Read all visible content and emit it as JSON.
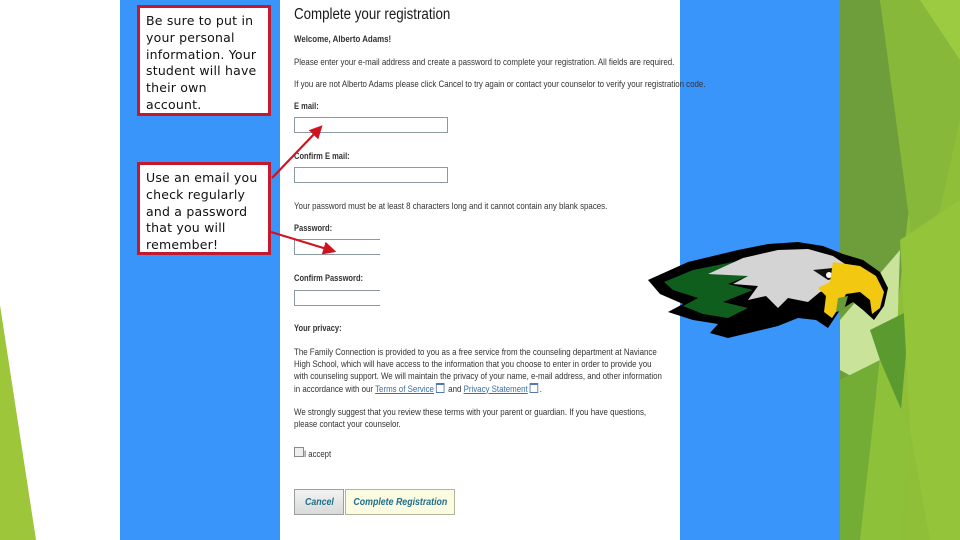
{
  "colors": {
    "blue_panel": "#3a95fb",
    "callout_border": "#c4182d",
    "arrow": "#d0141f",
    "green_light": "#9dc63a",
    "green_mid": "#78ad34",
    "green_dark": "#5e9a31",
    "link": "#3a6fa8"
  },
  "callouts": [
    {
      "text": "Be sure to put in your personal information.  Your student will have their own account."
    },
    {
      "text": "Use an email you check regularly and a password that you will remember!"
    }
  ],
  "form": {
    "title": "Complete your registration",
    "welcome": "Welcome, Alberto Adams!",
    "instructions": "Please enter your e-mail address and create a password to complete your registration. All fields are required.",
    "not_user_notice": "If you are not Alberto Adams please click Cancel to try again or contact your counselor to verify your registration code.",
    "email": {
      "label": "E mail:",
      "value": ""
    },
    "confirm_email": {
      "label": "Confirm E mail:",
      "value": ""
    },
    "password_rule": "Your password must be at least 8 characters long and it cannot contain any blank spaces.",
    "password": {
      "label": "Password:",
      "value": ""
    },
    "confirm_password": {
      "label": "Confirm Password:",
      "value": ""
    },
    "privacy": {
      "heading": "Your privacy:",
      "para1_prefix": "The Family Connection is provided to you as a free service from the counseling department at Naviance High School, which will have access to the information that you choose to enter in order to provide you with counseling support. We will maintain the privacy of your name, e-mail address, and other information in accordance with our ",
      "terms_link": "Terms of Service",
      "and": " and ",
      "privacy_link": "Privacy Statement",
      "para1_suffix": ".",
      "para2": "We strongly suggest that you review these terms with your parent or guardian. If you have questions, please contact your counselor."
    },
    "accept_label": "I accept",
    "accept_checked": false,
    "cancel_label": "Cancel",
    "complete_label": "Complete Registration"
  },
  "mascot": {
    "icon": "eagle-head-logo"
  }
}
